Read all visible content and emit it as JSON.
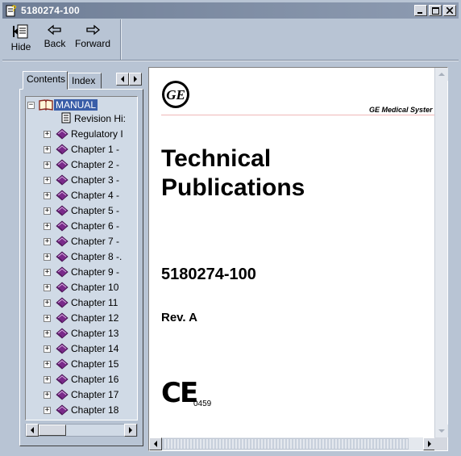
{
  "window": {
    "title": "5180274-100",
    "controls": [
      "minimize",
      "maximize",
      "close"
    ]
  },
  "toolbar": {
    "hide_label": "Hide",
    "back_label": "Back",
    "forward_label": "Forward"
  },
  "nav_tabs": {
    "contents": "Contents",
    "index": "Index"
  },
  "tree": {
    "root": "MANUAL",
    "items": [
      {
        "label": "Revision Hi:",
        "type": "page"
      },
      {
        "label": "Regulatory I",
        "type": "book"
      },
      {
        "label": "Chapter 1 -",
        "type": "book"
      },
      {
        "label": "Chapter 2 -",
        "type": "book"
      },
      {
        "label": "Chapter 3 -",
        "type": "book"
      },
      {
        "label": "Chapter 4 -",
        "type": "book"
      },
      {
        "label": "Chapter 5 -",
        "type": "book"
      },
      {
        "label": "Chapter 6 -",
        "type": "book"
      },
      {
        "label": "Chapter 7 -",
        "type": "book"
      },
      {
        "label": "Chapter 8 -.",
        "type": "book"
      },
      {
        "label": "Chapter 9 -",
        "type": "book"
      },
      {
        "label": "Chapter 10",
        "type": "book"
      },
      {
        "label": "Chapter 11",
        "type": "book"
      },
      {
        "label": "Chapter 12",
        "type": "book"
      },
      {
        "label": "Chapter 13",
        "type": "book"
      },
      {
        "label": "Chapter 14",
        "type": "book"
      },
      {
        "label": "Chapter 15",
        "type": "book"
      },
      {
        "label": "Chapter 16",
        "type": "book"
      },
      {
        "label": "Chapter 17",
        "type": "book"
      },
      {
        "label": "Chapter 18",
        "type": "book"
      }
    ]
  },
  "document": {
    "logo": "GE",
    "brand": "GE Medical Syster",
    "title_line1": "Technical",
    "title_line2": "Publications",
    "doc_number": "5180274-100",
    "revision": "Rev. A",
    "ce_mark": "CE",
    "ce_number": "0459"
  },
  "colors": {
    "chrome": "#b8c4d4",
    "titlebar": "#6f7e96",
    "tree_bg": "#d0dae6",
    "book_purple": "#7a2a8a",
    "rule_pink": "#f0b8b8"
  }
}
